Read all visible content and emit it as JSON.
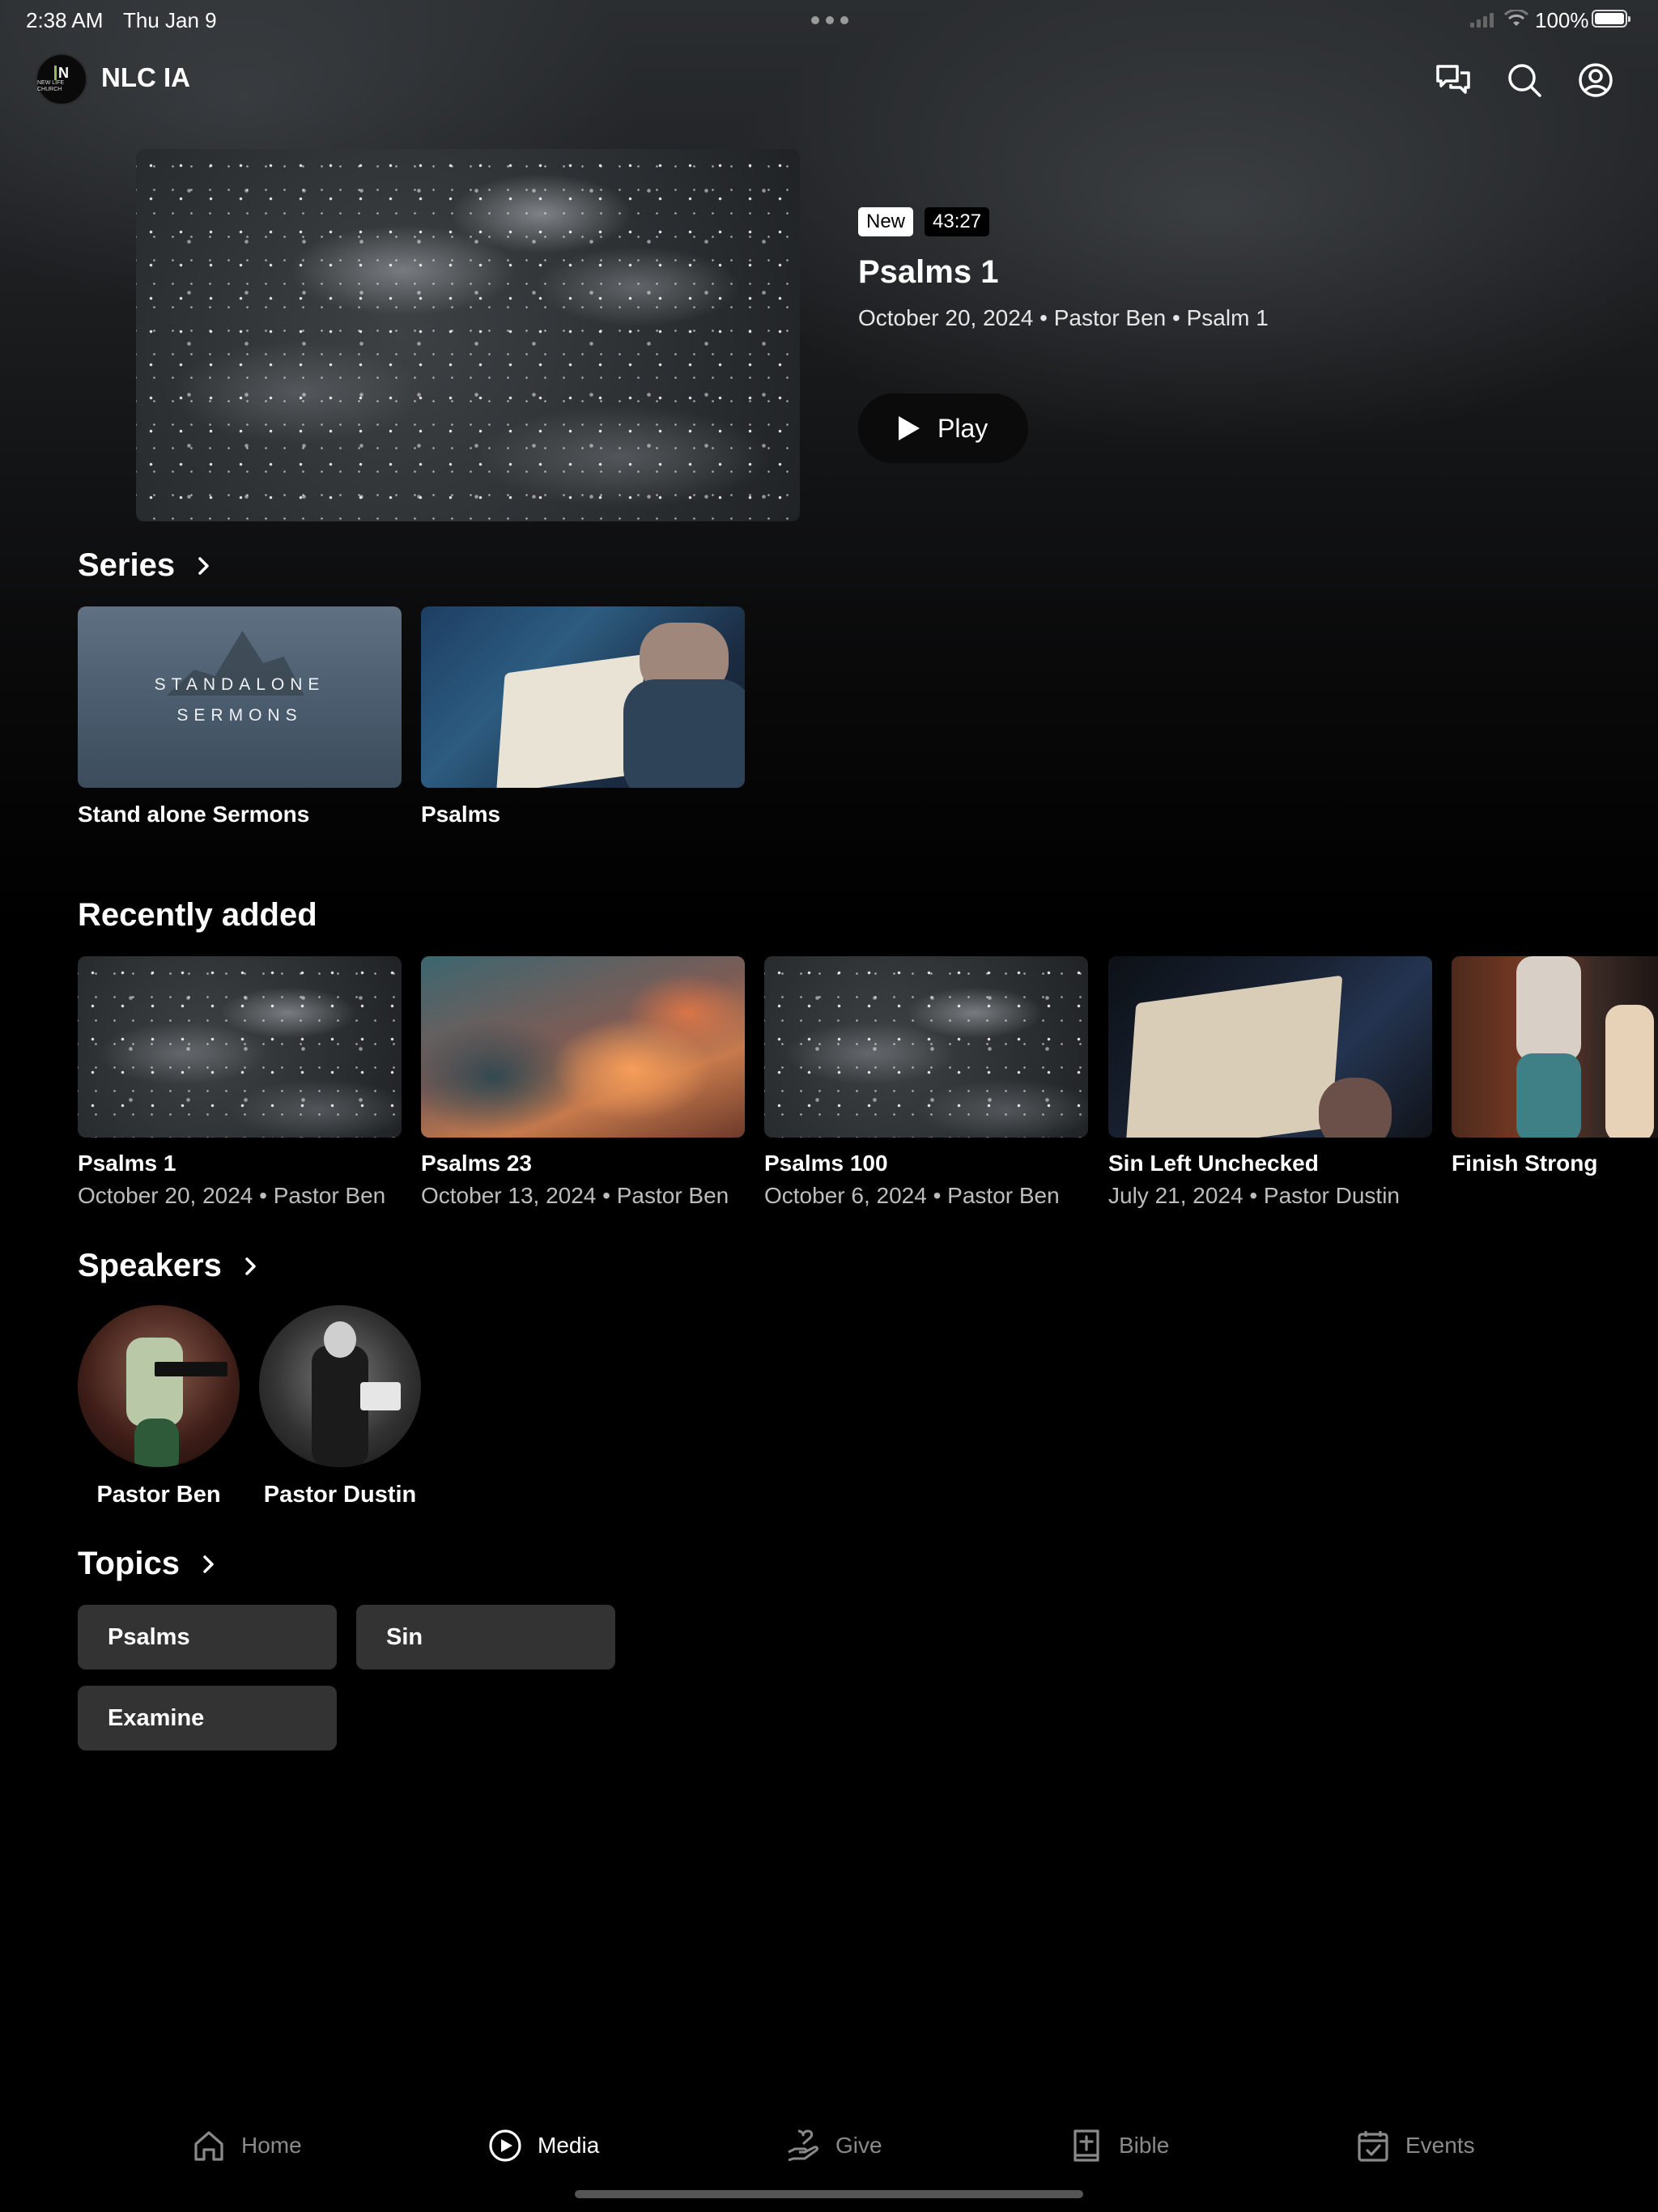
{
  "status_bar": {
    "time": "2:38 AM",
    "date": "Thu Jan 9",
    "battery": "100%"
  },
  "header": {
    "app_title": "NLC IA",
    "logo_text": "NEW LIFE CHURCH",
    "icons": [
      "chat-icon",
      "search-icon",
      "account-icon"
    ]
  },
  "hero": {
    "badge_new": "New",
    "duration": "43:27",
    "title": "Psalms 1",
    "meta": "October 20, 2024 • Pastor Ben • Psalm 1",
    "play_label": "Play"
  },
  "series": {
    "heading": "Series",
    "items": [
      {
        "title": "Stand alone Sermons",
        "thumb_text": "STANDALONE SERMONS"
      },
      {
        "title": "Psalms"
      }
    ]
  },
  "recent": {
    "heading": "Recently added",
    "items": [
      {
        "title": "Psalms 1",
        "meta": "October 20, 2024 • Pastor Ben"
      },
      {
        "title": "Psalms 23",
        "meta": "October 13, 2024 • Pastor Ben"
      },
      {
        "title": "Psalms 100",
        "meta": "October 6, 2024 • Pastor Ben"
      },
      {
        "title": "Sin Left Unchecked",
        "meta": "July 21, 2024 • Pastor Dustin"
      },
      {
        "title": "Finish Strong",
        "meta": ""
      }
    ]
  },
  "speakers": {
    "heading": "Speakers",
    "items": [
      {
        "name": "Pastor Ben"
      },
      {
        "name": "Pastor Dustin"
      }
    ]
  },
  "topics": {
    "heading": "Topics",
    "items": [
      "Psalms",
      "Sin",
      "Examine"
    ]
  },
  "tabbar": {
    "active": "Media",
    "items": [
      {
        "label": "Home",
        "icon": "home-icon"
      },
      {
        "label": "Media",
        "icon": "play-circle-icon"
      },
      {
        "label": "Give",
        "icon": "give-icon"
      },
      {
        "label": "Bible",
        "icon": "bible-icon"
      },
      {
        "label": "Events",
        "icon": "calendar-icon"
      }
    ]
  }
}
